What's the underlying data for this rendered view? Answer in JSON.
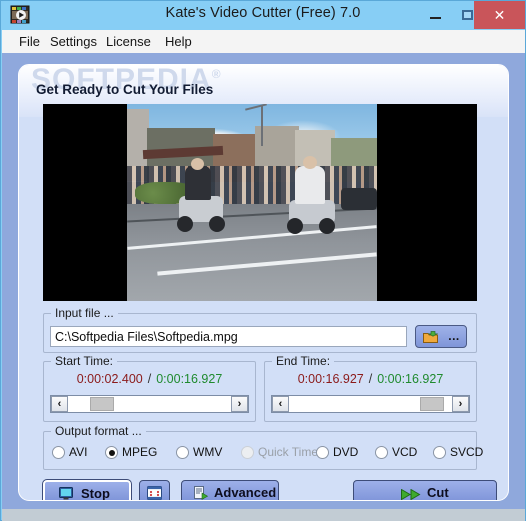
{
  "window": {
    "title": "Kate's Video Cutter (Free) 7.0",
    "icon": "video-app-icon",
    "controls": {
      "minimize": "minimize-icon",
      "maximize": "maximize-icon",
      "close": "✕"
    }
  },
  "menu": {
    "items": [
      {
        "label": "File",
        "name": "menu-file"
      },
      {
        "label": "Settings",
        "name": "menu-settings"
      },
      {
        "label": "License",
        "name": "menu-license"
      },
      {
        "label": "Help",
        "name": "menu-help"
      }
    ]
  },
  "panel": {
    "heading": "Get Ready to Cut Your Files",
    "watermark": "SOFTPEDIA",
    "watermark_mark": "®"
  },
  "preview": {
    "name": "video-preview",
    "description": "street scene with mobility scooters"
  },
  "input_file": {
    "group_label": "Input file ...",
    "value": "C:\\Softpedia Files\\Softpedia.mpg",
    "placeholder": "",
    "browse_label": "...",
    "browse_icon": "folder-open-icon"
  },
  "start_time": {
    "group_label": "Start Time:",
    "current": "0:00:02.400",
    "separator": "/",
    "total": "0:00:16.927",
    "scroll_left": "‹",
    "scroll_right": "›"
  },
  "end_time": {
    "group_label": "End Time:",
    "current": "0:00:16.927",
    "separator": "/",
    "total": "0:00:16.927",
    "scroll_left": "‹",
    "scroll_right": "›"
  },
  "output_format": {
    "group_label": "Output format ...",
    "options": [
      {
        "label": "AVI",
        "checked": false,
        "disabled": false
      },
      {
        "label": "MPEG",
        "checked": true,
        "disabled": false
      },
      {
        "label": "WMV",
        "checked": false,
        "disabled": false
      },
      {
        "label": "Quick Time",
        "checked": false,
        "disabled": true
      },
      {
        "label": "DVD",
        "checked": false,
        "disabled": false
      },
      {
        "label": "VCD",
        "checked": false,
        "disabled": false
      },
      {
        "label": "SVCD",
        "checked": false,
        "disabled": false
      }
    ]
  },
  "actions": {
    "stop_label": "Stop",
    "stop_icon": "monitor-stop-icon",
    "frame_icon": "film-frame-icon",
    "advanced_label": "Advanced",
    "advanced_icon": "advanced-settings-icon",
    "cut_label": "Cut",
    "cut_icon": "fast-forward-icon"
  },
  "colors": {
    "titlebar": "#87CEF5",
    "close_button": "#C9555A",
    "panel_bg": "#D2DFF7",
    "body_bg": "#8FA8DC",
    "button_face": "#8FA3E0",
    "time_current": "#8B1A1A",
    "time_total": "#1F8A2E",
    "cut_icon_green": "#3FAA2E"
  }
}
